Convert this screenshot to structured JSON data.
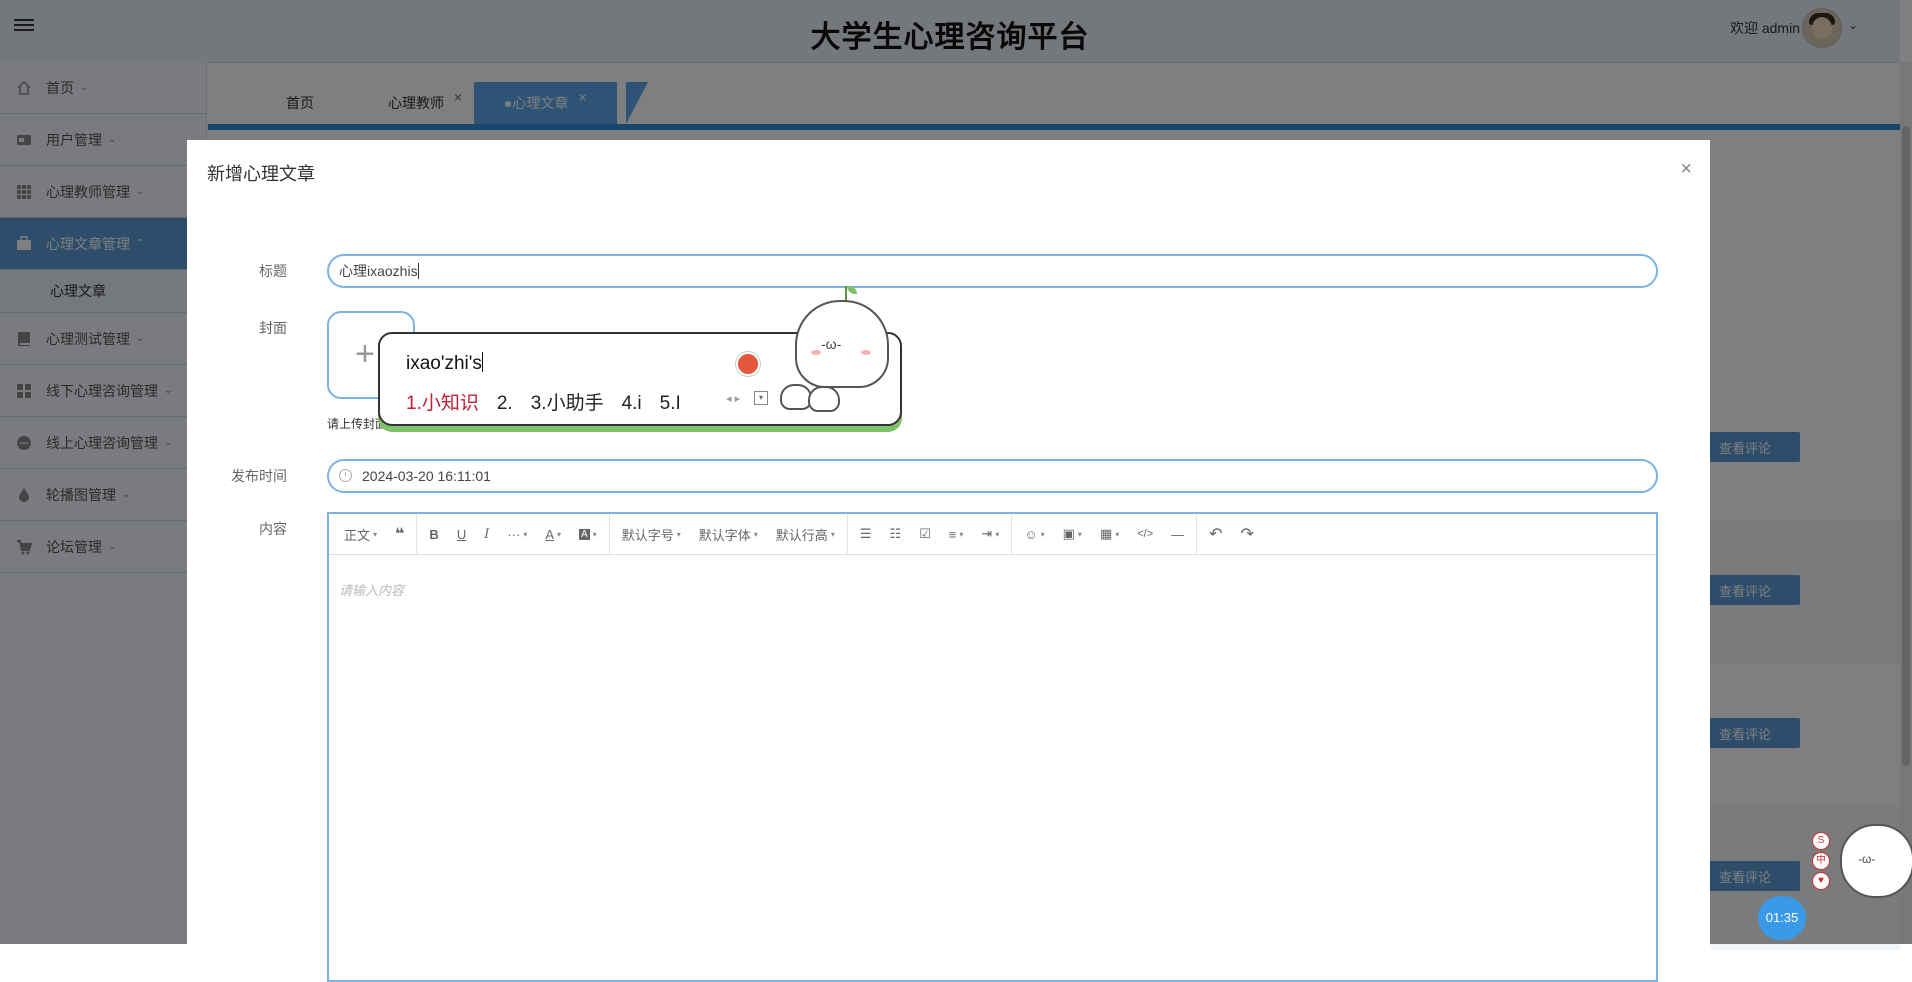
{
  "app": {
    "title": "大学生心理咨询平台"
  },
  "header": {
    "welcome": "欢迎 admin",
    "user_caret": "⌄"
  },
  "sidebar": {
    "items": [
      {
        "label": "首页",
        "icon": "home-icon"
      },
      {
        "label": "用户管理",
        "icon": "user-card-icon"
      },
      {
        "label": "心理教师管理",
        "icon": "grid-icon"
      },
      {
        "label": "心理文章管理",
        "icon": "briefcase-icon"
      },
      {
        "label": "心理测试管理",
        "icon": "book-icon"
      },
      {
        "label": "线下心理咨询管理",
        "icon": "apps-icon"
      },
      {
        "label": "线上心理咨询管理",
        "icon": "chat-dots-icon"
      },
      {
        "label": "轮播图管理",
        "icon": "drop-icon"
      },
      {
        "label": "论坛管理",
        "icon": "cart-icon"
      }
    ],
    "sub_item": "心理文章",
    "caret_down": "⌄",
    "caret_up": "⌃"
  },
  "tabs": [
    {
      "label": "首页"
    },
    {
      "label": "心理教师",
      "close": "×"
    },
    {
      "label": "●心理文章",
      "close": "×"
    }
  ],
  "background": {
    "comment_button": "查看评论"
  },
  "modal": {
    "title": "新增心理文章",
    "close": "×",
    "fields": {
      "title_label": "标题",
      "title_value": "心理ixaozhis",
      "cover_label": "封面",
      "cover_plus": "+",
      "cover_hint": "请上传封面",
      "time_label": "发布时间",
      "time_value": "2024-03-20 16:11:01",
      "content_label": "内容",
      "content_placeholder": "请输入内容"
    },
    "toolbar": {
      "paragraph": "正文",
      "quote": "❝",
      "bold": "B",
      "underline": "U",
      "italic": "I",
      "more": "···",
      "font_color": "A",
      "bg_color": "A",
      "font_size": "默认字号",
      "font_family": "默认字体",
      "line_height": "默认行高",
      "bullet_list": "☰",
      "numbered_list": "☷",
      "todo": "☑",
      "align": "≡",
      "indent": "⇥",
      "emoji": "☺",
      "image": "▣",
      "table": "▦",
      "code": "</>",
      "divider": "—",
      "undo": "↶",
      "redo": "↷",
      "dropdown": "▾"
    }
  },
  "ime": {
    "pinyin": "ixao'zhi's",
    "candidates": [
      "1.小知识",
      "2.",
      "3.小助手",
      "4.i",
      "5.I"
    ],
    "arrows": "◂ ▸",
    "expand": "▾",
    "mascot_face": "-ω-"
  },
  "widgets": {
    "timer": "01:35",
    "side_buttons": [
      "S",
      "中",
      "♥"
    ],
    "corner_face": "-ω-"
  }
}
